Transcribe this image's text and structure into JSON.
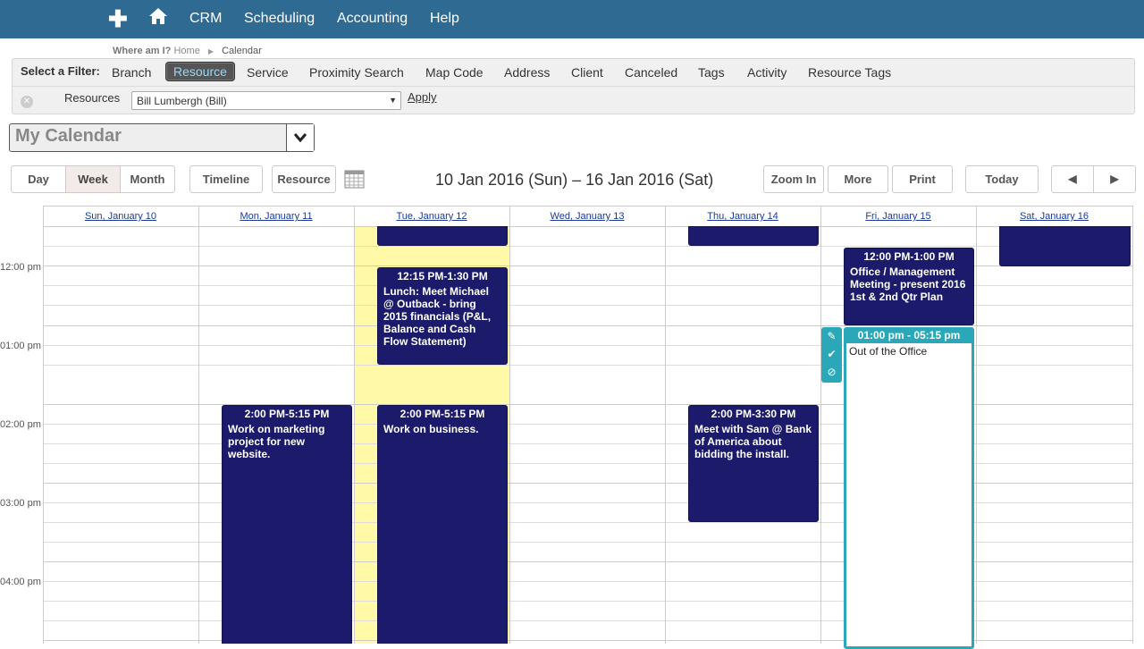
{
  "nav": {
    "items": [
      "CRM",
      "Scheduling",
      "Accounting",
      "Help"
    ]
  },
  "breadcrumb": {
    "label": "Where am I?",
    "home": "Home",
    "current": "Calendar"
  },
  "filter": {
    "label": "Select a Filter:",
    "tabs": [
      "Branch",
      "Resource",
      "Service",
      "Proximity Search",
      "Map Code",
      "Address",
      "Client",
      "Canceled",
      "Tags",
      "Activity",
      "Resource Tags"
    ],
    "active_tab": "Resource",
    "resources_label": "Resources",
    "resources_value": "Bill Lumbergh (Bill)",
    "apply_label": "Apply"
  },
  "calendar_select": {
    "value": "My Calendar"
  },
  "toolbar": {
    "day": "Day",
    "week": "Week",
    "month": "Month",
    "timeline": "Timeline",
    "resource": "Resource",
    "date_range": "10 Jan 2016 (Sun) – 16 Jan 2016 (Sat)",
    "zoom_in": "Zoom In",
    "more": "More",
    "print": "Print",
    "today": "Today",
    "prev": "◀",
    "next": "▶"
  },
  "days": [
    "Sun, January 10",
    "Mon, January 11",
    "Tue, January 12",
    "Wed, January 13",
    "Thu, January 14",
    "Fri, January 15",
    "Sat, January 16"
  ],
  "times": [
    "12:00 pm",
    "01:00 pm",
    "02:00 pm",
    "03:00 pm",
    "04:00 pm"
  ],
  "events": {
    "tue_lunch": {
      "time": "12:15 PM-1:30 PM",
      "desc": "Lunch: Meet Michael @ Outback - bring 2015 financials (P&L, Balance and Cash Flow Statement)"
    },
    "mon_marketing": {
      "time": "2:00 PM-5:15 PM",
      "desc": "Work on marketing project for new website."
    },
    "tue_business": {
      "time": "2:00 PM-5:15 PM",
      "desc": "Work on business."
    },
    "thu_sam": {
      "time": "2:00 PM-3:30 PM",
      "desc": "Meet with Sam @ Bank of America about bidding the install."
    },
    "fri_meeting": {
      "time": "12:00 PM-1:00 PM",
      "desc": "Office / Management Meeting - present 2016 1st & 2nd Qtr Plan"
    },
    "fri_ooo": {
      "time": "01:00 pm - 05:15 pm",
      "desc": "Out of the Office"
    }
  }
}
